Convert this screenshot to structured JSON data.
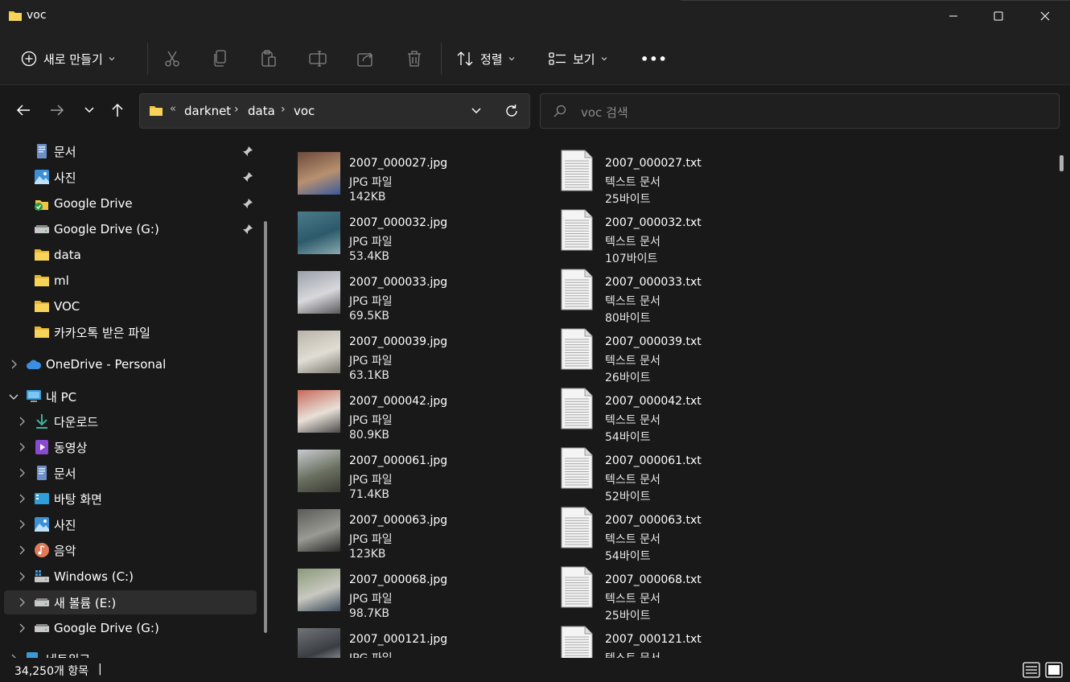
{
  "window": {
    "title": "voc",
    "minimize_glyph": "—",
    "maximize_glyph": "☐",
    "close_glyph": "✕"
  },
  "toolbar": {
    "new_label": "새로 만들기",
    "sort_label": "정렬",
    "view_label": "보기",
    "more_label": "•••"
  },
  "address": {
    "overflow": "«",
    "crumbs": [
      "darknet",
      "data",
      "voc"
    ],
    "search_placeholder": "voc 검색"
  },
  "sidebar": {
    "quick_access": [
      {
        "label": "문서",
        "icon": "documents-icon",
        "pinned": true
      },
      {
        "label": "사진",
        "icon": "pictures-icon",
        "pinned": true
      },
      {
        "label": "Google Drive",
        "icon": "google-drive-icon",
        "pinned": true
      },
      {
        "label": "Google Drive (G:)",
        "icon": "drive-icon",
        "pinned": true
      },
      {
        "label": "data",
        "icon": "folder-icon",
        "pinned": false
      },
      {
        "label": "ml",
        "icon": "folder-icon",
        "pinned": false
      },
      {
        "label": "VOC",
        "icon": "folder-icon",
        "pinned": false
      },
      {
        "label": "카카오톡 받은 파일",
        "icon": "folder-icon",
        "pinned": false
      }
    ],
    "onedrive": "OneDrive - Personal",
    "this_pc": "내 PC",
    "pc_items": [
      {
        "label": "다운로드",
        "icon": "downloads-icon"
      },
      {
        "label": "동영상",
        "icon": "videos-icon"
      },
      {
        "label": "문서",
        "icon": "documents-icon"
      },
      {
        "label": "바탕 화면",
        "icon": "desktop-icon"
      },
      {
        "label": "사진",
        "icon": "pictures-icon"
      },
      {
        "label": "음악",
        "icon": "music-icon"
      },
      {
        "label": "Windows (C:)",
        "icon": "windows-drive-icon"
      },
      {
        "label": "새 볼륨 (E:)",
        "icon": "drive-icon"
      },
      {
        "label": "Google Drive (G:)",
        "icon": "drive-icon"
      }
    ],
    "network": "네트워크"
  },
  "files": [
    {
      "jpg": "2007_000027.jpg",
      "jpg_type": "JPG 파일",
      "jpg_size": "142KB",
      "txt": "2007_000027.txt",
      "txt_type": "텍스트 문서",
      "txt_size": "25바이트",
      "thumb": [
        "#6b4a3a",
        "#b89070",
        "#3a5a9a"
      ]
    },
    {
      "jpg": "2007_000032.jpg",
      "jpg_type": "JPG 파일",
      "jpg_size": "53.4KB",
      "txt": "2007_000032.txt",
      "txt_type": "텍스트 문서",
      "txt_size": "107바이트",
      "thumb": [
        "#4a7a8a",
        "#2d5a6a",
        "#8aaab0"
      ]
    },
    {
      "jpg": "2007_000033.jpg",
      "jpg_type": "JPG 파일",
      "jpg_size": "69.5KB",
      "txt": "2007_000033.txt",
      "txt_type": "텍스트 문서",
      "txt_size": "80바이트",
      "thumb": [
        "#9aa0a8",
        "#d8d8dc",
        "#5a5a5a"
      ]
    },
    {
      "jpg": "2007_000039.jpg",
      "jpg_type": "JPG 파일",
      "jpg_size": "63.1KB",
      "txt": "2007_000039.txt",
      "txt_type": "텍스트 문서",
      "txt_size": "26바이트",
      "thumb": [
        "#b8b4a8",
        "#e0ddd4",
        "#7a7a72"
      ]
    },
    {
      "jpg": "2007_000042.jpg",
      "jpg_type": "JPG 파일",
      "jpg_size": "80.9KB",
      "txt": "2007_000042.txt",
      "txt_type": "텍스트 문서",
      "txt_size": "54바이트",
      "thumb": [
        "#c86a5a",
        "#e8e0d8",
        "#4a4a4a"
      ]
    },
    {
      "jpg": "2007_000061.jpg",
      "jpg_type": "JPG 파일",
      "jpg_size": "71.4KB",
      "txt": "2007_000061.txt",
      "txt_type": "텍스트 문서",
      "txt_size": "52바이트",
      "thumb": [
        "#c8ccd0",
        "#6a7060",
        "#3a3a34"
      ]
    },
    {
      "jpg": "2007_000063.jpg",
      "jpg_type": "JPG 파일",
      "jpg_size": "123KB",
      "txt": "2007_000063.txt",
      "txt_type": "텍스트 문서",
      "txt_size": "54바이트",
      "thumb": [
        "#5a5a58",
        "#9a9a94",
        "#2a2a28"
      ]
    },
    {
      "jpg": "2007_000068.jpg",
      "jpg_type": "JPG 파일",
      "jpg_size": "98.7KB",
      "txt": "2007_000068.txt",
      "txt_type": "텍스트 문서",
      "txt_size": "25바이트",
      "thumb": [
        "#8a9a7a",
        "#c8c8c0",
        "#3a4a5a"
      ]
    },
    {
      "jpg": "2007_000121.jpg",
      "jpg_type": "JPG 파일",
      "jpg_size": "",
      "txt": "2007_000121.txt",
      "txt_type": "텍스트 문서",
      "txt_size": "",
      "thumb": [
        "#707478",
        "#3a3e42",
        "#c0c4c8"
      ]
    }
  ],
  "status": {
    "count": "34,250개 항목",
    "separator": "|"
  },
  "colors": {
    "folder": "#f4c542",
    "background": "#191919",
    "chrome": "#202020",
    "accent": "#4aa3df"
  }
}
